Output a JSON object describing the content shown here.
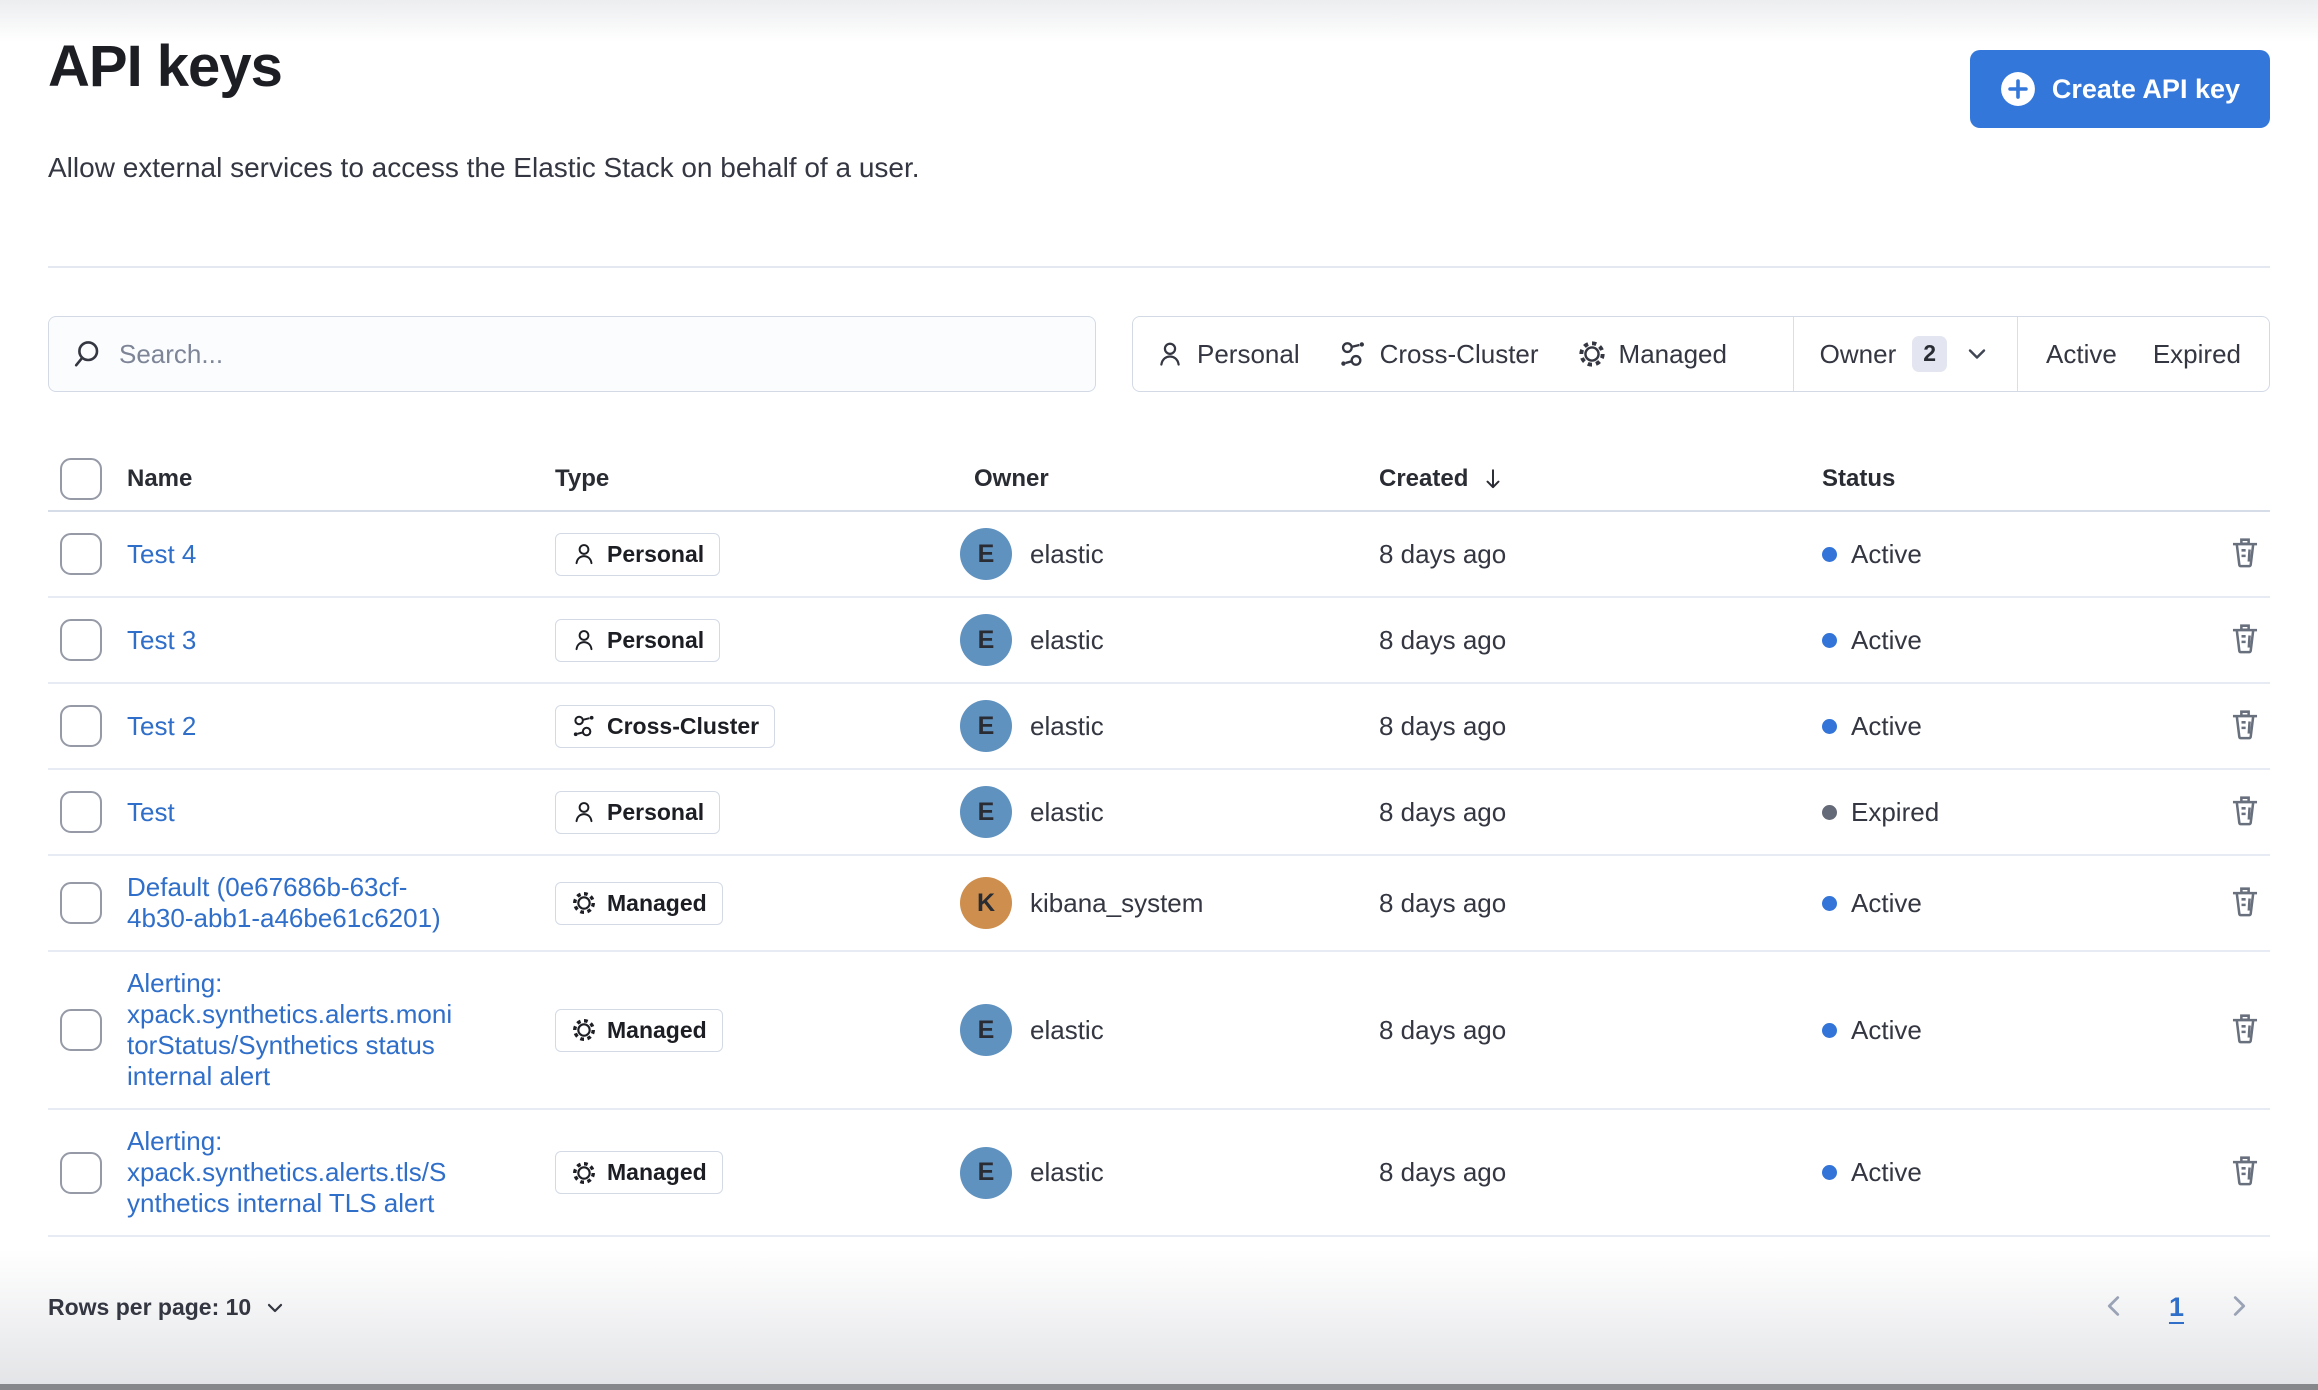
{
  "header": {
    "title": "API keys",
    "subtitle": "Allow external services to access the Elastic Stack on behalf of a user.",
    "create_button_label": "Create API key"
  },
  "search": {
    "placeholder": "Search..."
  },
  "filter_bar": {
    "personal_label": "Personal",
    "cross_cluster_label": "Cross-Cluster",
    "managed_label": "Managed",
    "owner_label": "Owner",
    "owner_count": "2",
    "active_label": "Active",
    "expired_label": "Expired"
  },
  "table": {
    "columns": {
      "name": "Name",
      "type": "Type",
      "owner": "Owner",
      "created": "Created",
      "status": "Status"
    },
    "sort": {
      "column": "Created",
      "direction": "descending"
    },
    "rows": [
      {
        "name": "Test 4",
        "type": "Personal",
        "owner": "elastic",
        "owner_initial": "E",
        "created": "8 days ago",
        "status": "Active"
      },
      {
        "name": "Test 3",
        "type": "Personal",
        "owner": "elastic",
        "owner_initial": "E",
        "created": "8 days ago",
        "status": "Active"
      },
      {
        "name": "Test 2",
        "type": "Cross-Cluster",
        "owner": "elastic",
        "owner_initial": "E",
        "created": "8 days ago",
        "status": "Active"
      },
      {
        "name": "Test",
        "type": "Personal",
        "owner": "elastic",
        "owner_initial": "E",
        "created": "8 days ago",
        "status": "Expired"
      },
      {
        "name": "Default (0e67686b-63cf-4b30-abb1-a46be61c6201)",
        "type": "Managed",
        "owner": "kibana_system",
        "owner_initial": "K",
        "created": "8 days ago",
        "status": "Active"
      },
      {
        "name": "Alerting: xpack.synthetics.alerts.monitorStatus/Synthetics status internal alert",
        "type": "Managed",
        "owner": "elastic",
        "owner_initial": "E",
        "created": "8 days ago",
        "status": "Active"
      },
      {
        "name": "Alerting: xpack.synthetics.alerts.tls/Synthetics internal TLS alert",
        "type": "Managed",
        "owner": "elastic",
        "owner_initial": "E",
        "created": "8 days ago",
        "status": "Active"
      }
    ]
  },
  "pagination": {
    "rows_per_page_label": "Rows per page: 10",
    "current_page": "1"
  },
  "colors": {
    "button_blue": "#3377DB",
    "link_blue": "#2F6EC9",
    "active_dot": "#3374D9",
    "expired_dot": "#646A77",
    "avatar_blue": "#6092C0",
    "avatar_orange": "#CE8E4D"
  }
}
